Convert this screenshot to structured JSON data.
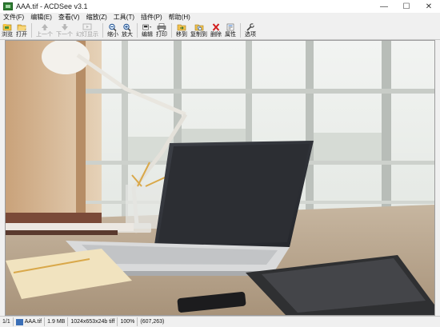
{
  "window": {
    "title": "AAA.tif - ACDSee v3.1",
    "controls": [
      "—",
      "☐",
      "✕"
    ]
  },
  "menu": [
    "文件(F)",
    "编辑(E)",
    "查看(V)",
    "缩放(Z)",
    "工具(T)",
    "插件(P)",
    "帮助(H)"
  ],
  "toolbar": {
    "browse": "浏览",
    "open": "打开",
    "prev": "上一个",
    "next": "下一个",
    "slideshow": "幻灯显示",
    "zoom_out": "缩小",
    "zoom_in": "放大",
    "edit": "编辑",
    "print": "打印",
    "move_to": "移到",
    "copy_to": "复制到",
    "delete": "删除",
    "properties": "属性",
    "options": "选项"
  },
  "status": {
    "position": "1/1",
    "filename": "AAA.tif",
    "size": "1.9 MB",
    "dimensions": "1024x653x24b tiff",
    "zoom": "100%",
    "cursor": "(607,263)"
  }
}
